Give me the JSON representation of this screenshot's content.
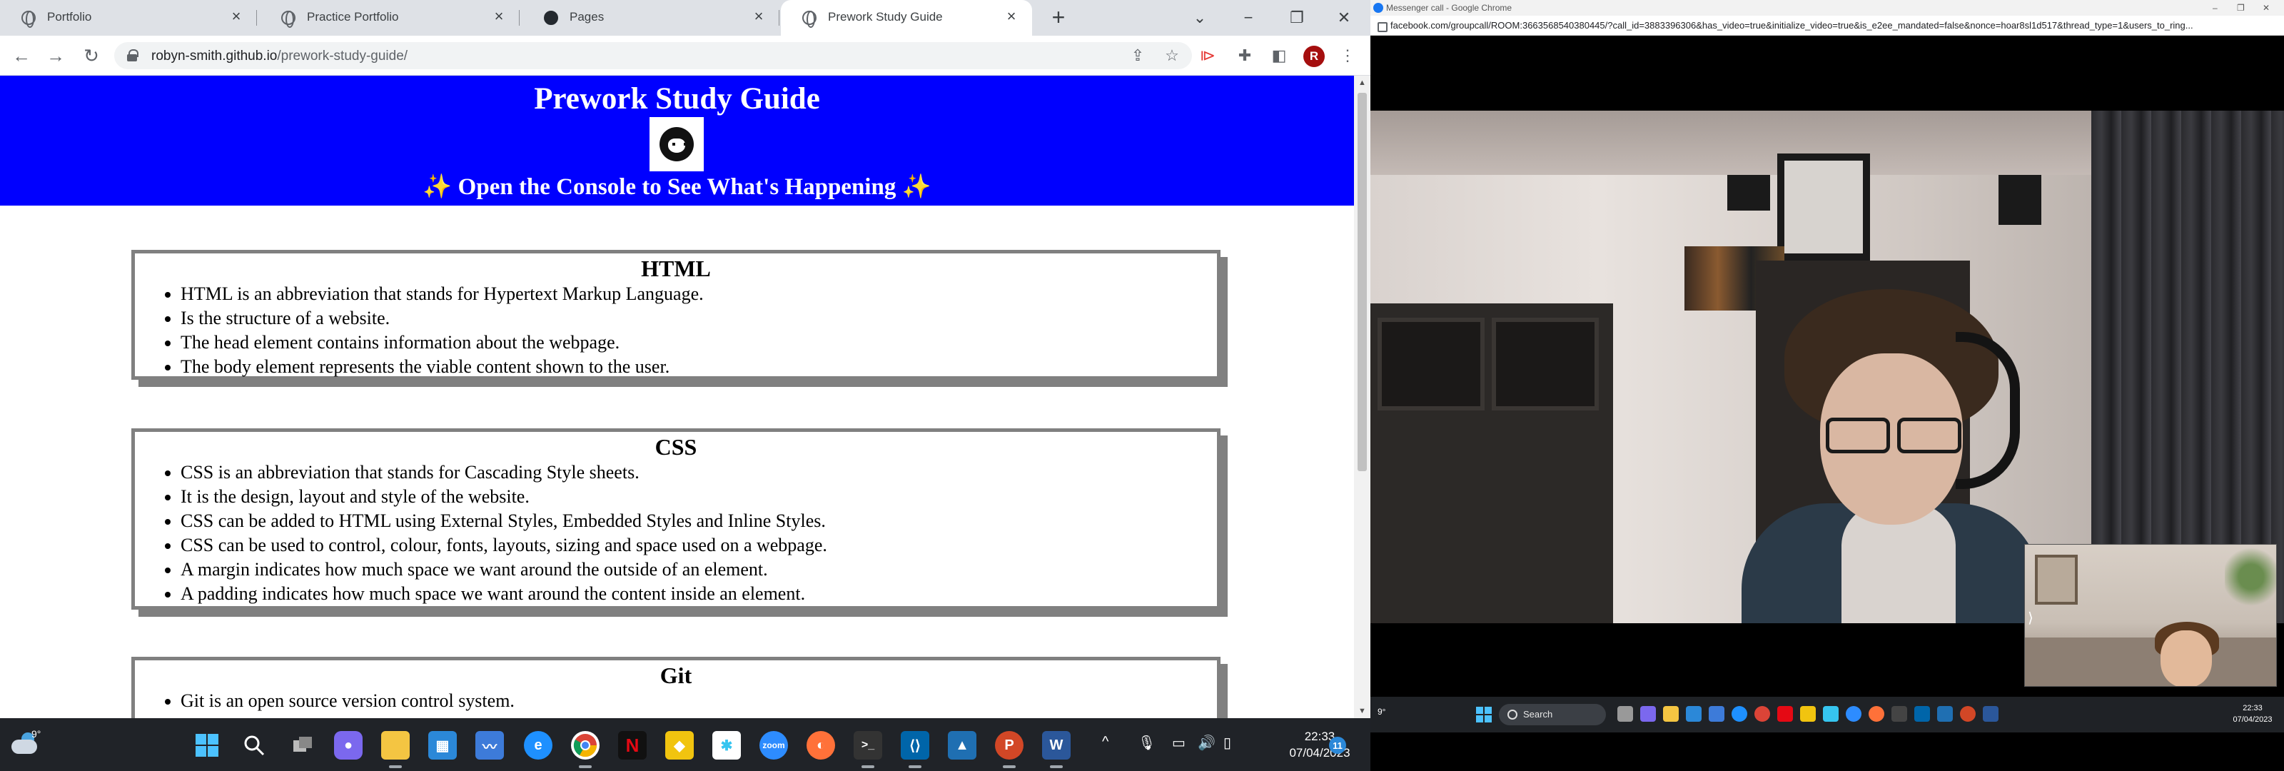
{
  "left_browser": {
    "tabs": [
      {
        "label": "Portfolio"
      },
      {
        "label": "Practice Portfolio"
      },
      {
        "label": "Pages"
      },
      {
        "label": "Prework Study Guide"
      }
    ],
    "new_tab_symbol": "+",
    "url_host": "robyn-smith.github.io",
    "url_path": "/prework-study-guide/",
    "profile_initial": "R"
  },
  "page": {
    "title": "Prework Study Guide",
    "subtitle_sparkle_left": "✨",
    "subtitle": "Open the Console to See What's Happening",
    "subtitle_sparkle_right": "✨",
    "sections": [
      {
        "heading": "HTML",
        "items": [
          "HTML is an abbreviation that stands for Hypertext Markup Language.",
          "Is the structure of a website.",
          "The head element contains information about the webpage.",
          "The body element represents the viable content shown to the user."
        ]
      },
      {
        "heading": "CSS",
        "items": [
          "CSS is an abbreviation that stands for Cascading Style sheets.",
          "It is the design, layout and style of the website.",
          "CSS can be added to HTML using External Styles, Embedded Styles and Inline Styles.",
          "CSS can be used to control, colour, fonts, layouts, sizing and space used on a webpage.",
          "A margin indicates how much space we want around the outside of an element.",
          "A padding indicates how much space we want around the content inside an element."
        ]
      },
      {
        "heading": "Git",
        "items": [
          "Git is an open source version control system."
        ]
      }
    ]
  },
  "taskbar_left": {
    "temperature": "9°",
    "time": "22:33",
    "date": "07/04/2023",
    "notification_count": "11"
  },
  "right_window": {
    "title": "Messenger call - Google Chrome",
    "url": "facebook.com/groupcall/ROOM:3663568540380445/?call_id=3883396306&has_video=true&initialize_video=true&is_e2ee_mandated=false&nonce=hoar8sl1d517&thread_type=1&users_to_ring...",
    "pip_chevron": "⟩"
  },
  "taskbar_right": {
    "temperature": "9°",
    "search_placeholder": "Search",
    "time": "22:33",
    "date": "07/04/2023"
  },
  "colors": {
    "header_blue": "#0000ff",
    "card_border": "#808080",
    "taskbar": "#202328"
  }
}
